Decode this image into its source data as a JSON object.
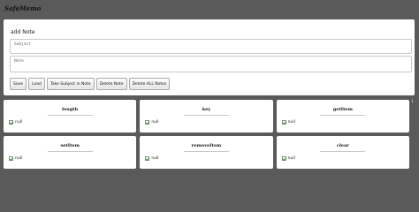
{
  "app": {
    "title": "SafeMemo"
  },
  "note_form": {
    "heading": "add Note",
    "subject_placeholder": "Subject",
    "note_placeholder": "Note",
    "buttons": {
      "save": "Save",
      "load": "Load",
      "take_subject": "Take Subject in Note",
      "delete_note": "Delete Note",
      "delete_all": "Delete ALL Notes"
    }
  },
  "cards": [
    {
      "title": "length",
      "result": "null"
    },
    {
      "title": "key",
      "result": "null"
    },
    {
      "title": "getItem",
      "result": "null"
    },
    {
      "title": "setItem",
      "result": "null"
    },
    {
      "title": "removeItem",
      "result": "null"
    },
    {
      "title": "clear",
      "result": "null"
    }
  ],
  "side_count": "1"
}
